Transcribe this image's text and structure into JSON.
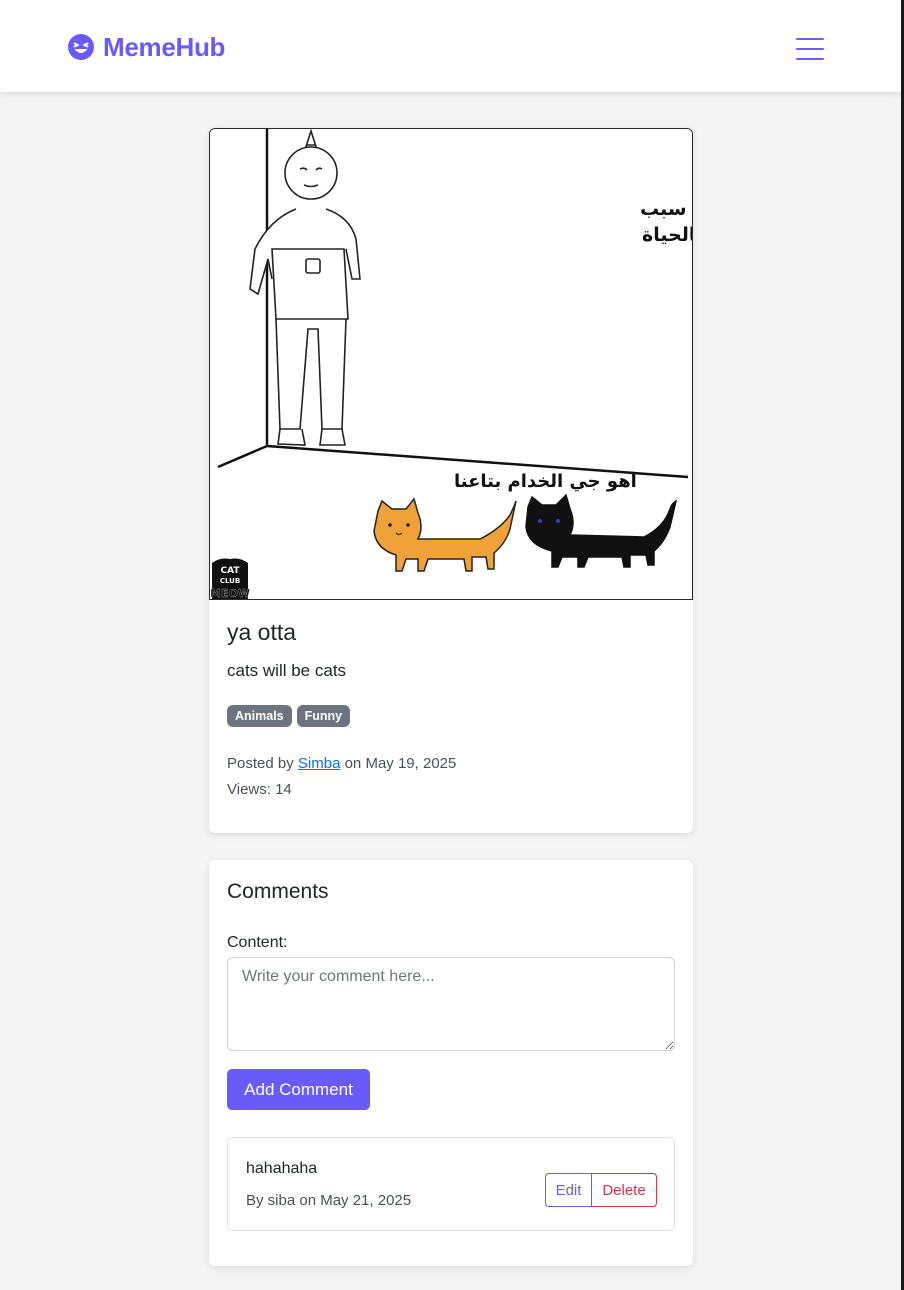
{
  "brand": {
    "name": "MemeHub",
    "icon": "laughing-face-icon",
    "color": "#6a5af9"
  },
  "nav": {
    "menu_icon": "hamburger-menu-icon"
  },
  "post": {
    "image_text": {
      "top_caption_line1": "اتمنى يعرفون انو هم سبب",
      "top_caption_line2": "سعادتي واستمراري بالحياة",
      "bottom_caption": "اهو جي الخدام بتاعنا",
      "watermark": "CAT CLUB MEOW"
    },
    "title": "ya otta",
    "description": "cats will be cats",
    "tags": [
      "Animals",
      "Funny"
    ],
    "posted_by_prefix": "Posted by",
    "author": "Simba",
    "posted_on": "on May 19, 2025",
    "views": "Views: 14"
  },
  "comments": {
    "heading": "Comments",
    "content_label": "Content:",
    "input_placeholder": "Write your comment here...",
    "submit_label": "Add Comment",
    "items": [
      {
        "text": "hahahaha",
        "meta": "By siba on May 21, 2025",
        "edit_label": "Edit",
        "delete_label": "Delete"
      }
    ]
  },
  "colors": {
    "accent": "#6a5af9",
    "danger": "#dc3545",
    "tag_bg": "#6c757d",
    "link": "#0d6efd"
  }
}
